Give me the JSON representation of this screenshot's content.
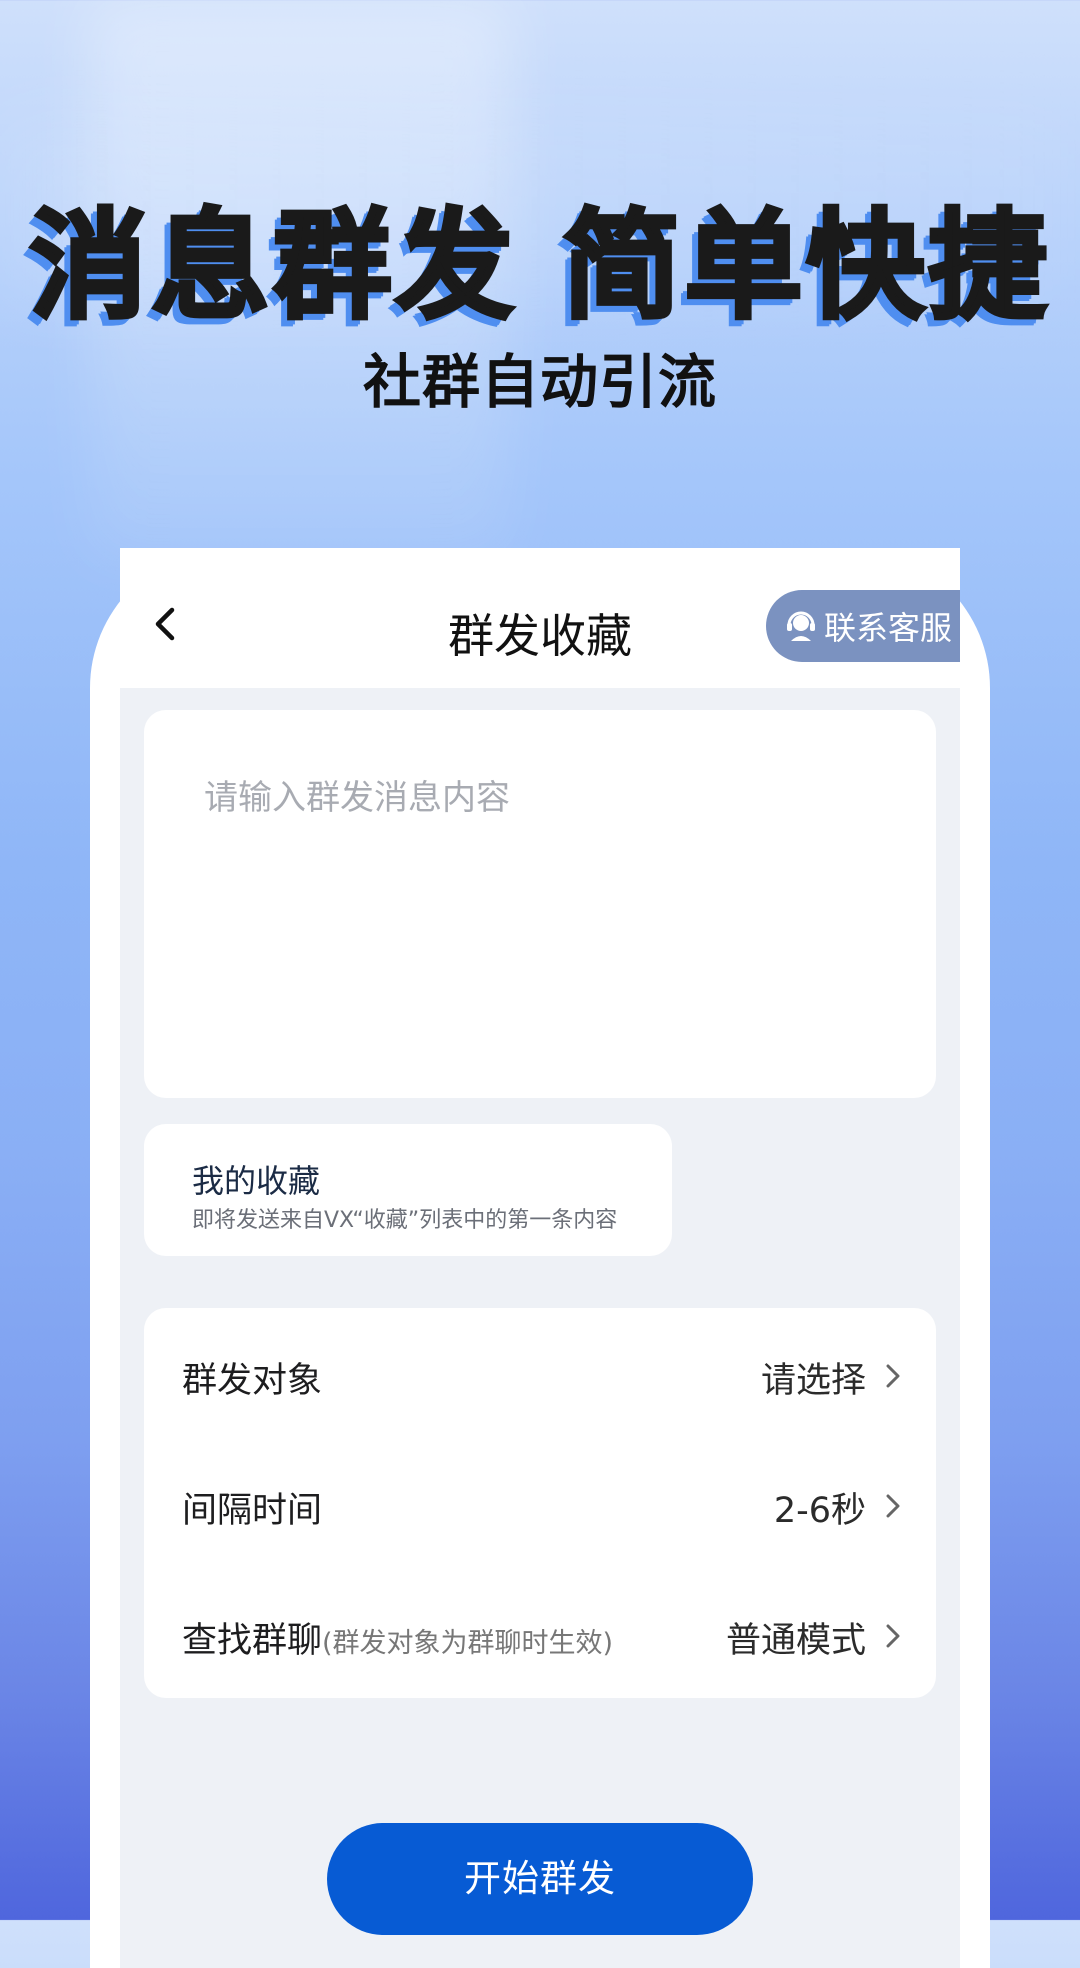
{
  "banner": {
    "headline": "消息群发 简单快捷",
    "subheadline": "社群自动引流"
  },
  "navbar": {
    "title": "群发收藏",
    "service_label": "联系客服",
    "back_icon": "chevron-left-icon",
    "service_icon": "headset-icon"
  },
  "message": {
    "placeholder": "请输入群发消息内容"
  },
  "favorites": {
    "title": "我的收藏",
    "description": "即将发送来自VX“收藏”列表中的第一条内容"
  },
  "settings": {
    "rows": [
      {
        "label": "群发对象",
        "hint": "",
        "value": "请选择"
      },
      {
        "label": "间隔时间",
        "hint": "",
        "value": "2-6秒"
      },
      {
        "label": "查找群聊",
        "hint": "(群发对象为群聊时生效)",
        "value": "普通模式"
      }
    ]
  },
  "actions": {
    "start_label": "开始群发"
  },
  "colors": {
    "primary": "#075bd4",
    "service_button": "#7b92c0",
    "page_background": "#eef1f6"
  }
}
